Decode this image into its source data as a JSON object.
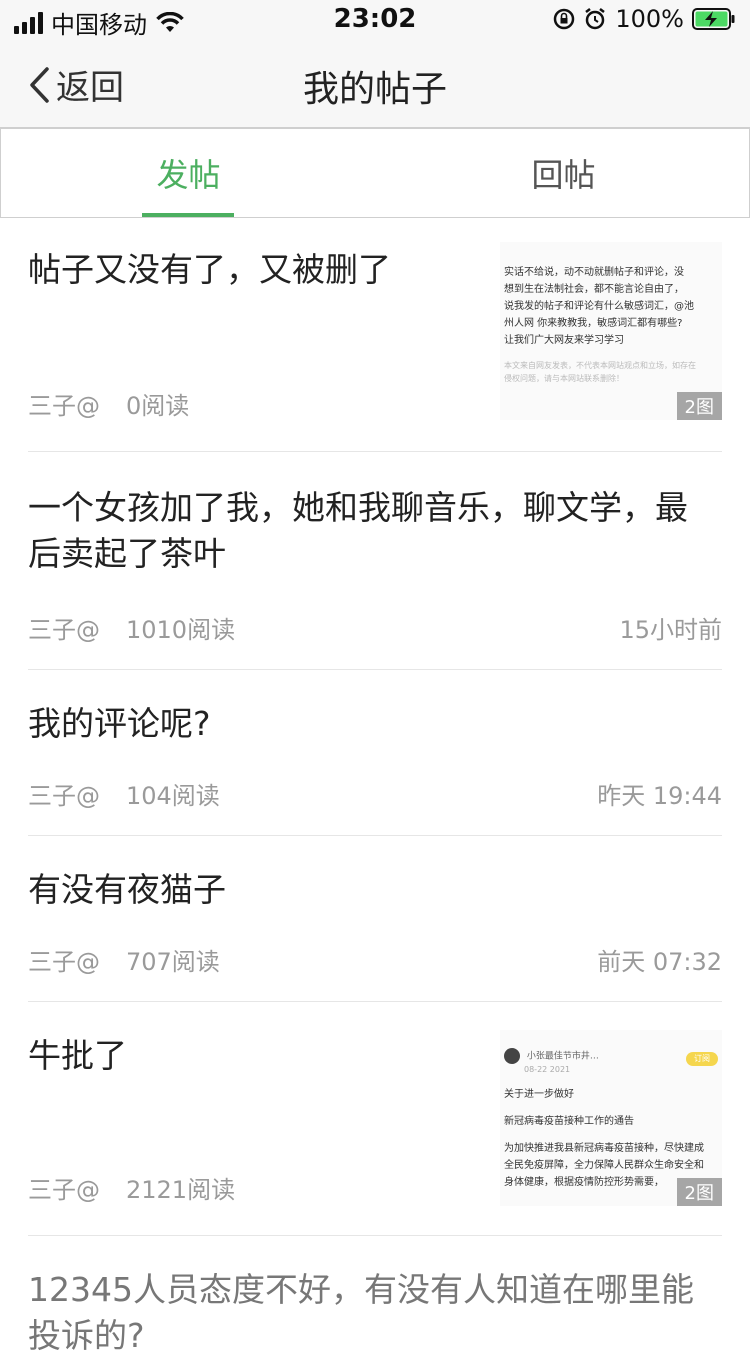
{
  "status_bar": {
    "carrier": "中国移动",
    "time": "23:02",
    "battery_percent": "100%"
  },
  "nav": {
    "back_label": "返回",
    "title": "我的帖子"
  },
  "tabs": {
    "post": "发帖",
    "reply": "回帖",
    "active": "post"
  },
  "colors": {
    "accent": "#4caf60"
  },
  "posts": [
    {
      "title": "帖子又没有了，又被删了",
      "author": "三子@",
      "reads": "0阅读",
      "time": "",
      "thumb_lines": [
        "实话不给说，动不动就删帖子和评论，没",
        "想到生在法制社会，都不能言论自由了，",
        "说我发的帖子和评论有什么敏感词汇，@池",
        "州人网 你来教教我，敏感词汇都有哪些?",
        "让我们广大网友来学习学习"
      ],
      "thumb_small": [
        "本文来自网友发表，不代表本网站观点和立场，如存在",
        "侵权问题，请与本网站联系删除！"
      ],
      "image_count": "2图"
    },
    {
      "title_line1": "一个女孩加了我，她和我聊音乐，聊文学，最",
      "title_line2": "后卖起了茶叶",
      "author": "三子@",
      "reads": "1010阅读",
      "time": "15小时前"
    },
    {
      "title": "我的评论呢?",
      "author": "三子@",
      "reads": "104阅读",
      "time": "昨天 19:44"
    },
    {
      "title": "有没有夜猫子",
      "author": "三子@",
      "reads": "707阅读",
      "time": "前天 07:32"
    },
    {
      "title": "牛批了",
      "author": "三子@",
      "reads": "2121阅读",
      "time": "",
      "thumb_user": "小张最佳节市井…",
      "thumb_date": "08-22 2021",
      "thumb_tag": "订阅",
      "thumb_lines": [
        "关于进一步做好",
        "新冠病毒疫苗接种工作的通告",
        "为加快推进我县新冠病毒疫苗接种，尽快建成",
        "全民免疫屏障，全力保障人民群众生命安全和",
        "身体健康，根据疫情防控形势需要，"
      ],
      "image_count": "2图"
    },
    {
      "title_line1": "12345人员态度不好，有没有人知道在哪里能",
      "title_line2": "投诉的?"
    }
  ]
}
